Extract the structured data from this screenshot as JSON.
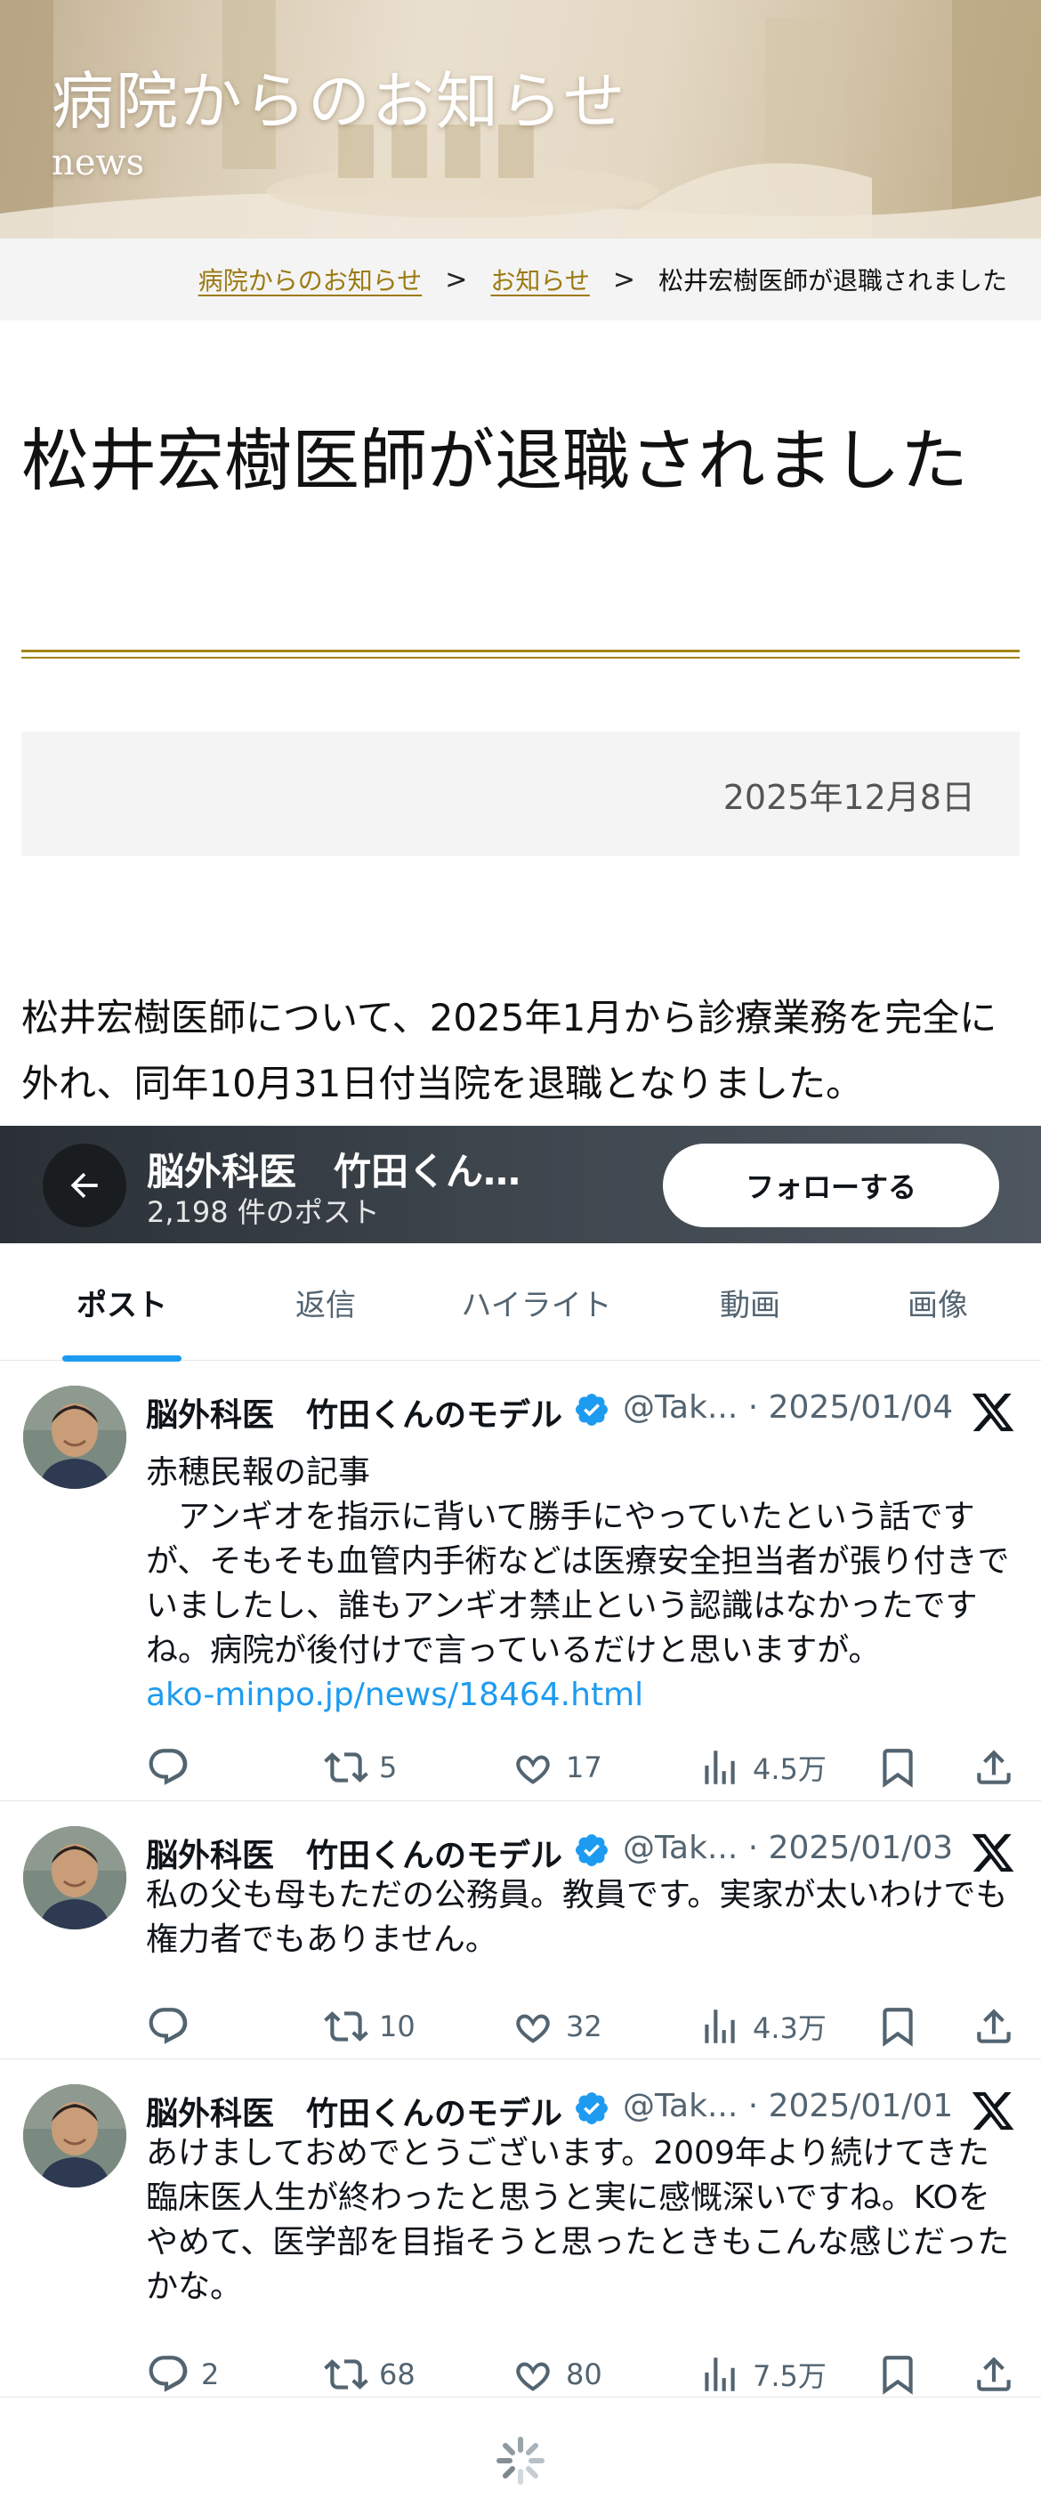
{
  "hero": {
    "title": "病院からのお知らせ",
    "subtitle": "news"
  },
  "breadcrumb": {
    "items": [
      {
        "label": "病院からのお知らせ"
      },
      {
        "label": "お知らせ"
      }
    ],
    "separator": ">",
    "current": "松井宏樹医師が退職されました"
  },
  "article": {
    "title": "松井宏樹医師が退職されました",
    "date": "2025年12月8日",
    "body": "松井宏樹医師について、2025年1月から診療業務を完全に外れ、同年10月31日付当院を退職となりました。"
  },
  "x_embed": {
    "profile_name": "脳外科医　竹田くん…",
    "post_count": "2,198 件のポスト",
    "follow_label": "フォローする",
    "tabs": [
      "ポスト",
      "返信",
      "ハイライト",
      "動画",
      "画像"
    ],
    "active_tab": 0,
    "tweets": [
      {
        "name": "脳外科医　竹田くんのモデル",
        "handle_date": "@Tak... · 2025/01/04",
        "text": "赤穂民報の記事\n　アンギオを指示に背いて勝手にやっていたという話ですが、そもそも血管内手術などは医療安全担当者が張り付きでいましたし、誰もアンギオ禁止という認識はなかったですね。病院が後付けで言っているだけと思いますが。",
        "link": "ako-minpo.jp/news/18464.html",
        "replies": "",
        "reposts": "5",
        "likes": "17",
        "views": "4.5万"
      },
      {
        "name": "脳外科医　竹田くんのモデル",
        "handle_date": "@Tak... · 2025/01/03",
        "text": "私の父も母もただの公務員。教員です。実家が太いわけでも権力者でもありません。",
        "link": "",
        "replies": "",
        "reposts": "10",
        "likes": "32",
        "views": "4.3万"
      },
      {
        "name": "脳外科医　竹田くんのモデル",
        "handle_date": "@Tak... · 2025/01/01",
        "text": "あけましておめでとうございます。2009年より続けてきた臨床医人生が終わったと思うと実に感慨深いですね。KOをやめて、医学部を目指そうと思ったときもこんな感じだったかな。",
        "link": "",
        "replies": "2",
        "reposts": "68",
        "likes": "80",
        "views": "7.5万"
      }
    ]
  },
  "colors": {
    "gold": "#9c7a12",
    "x_blue": "#1d9bf0",
    "x_gray": "#536471"
  },
  "icons": [
    "back-arrow-icon",
    "verified-badge-icon",
    "x-logo-icon",
    "reply-icon",
    "repost-icon",
    "like-icon",
    "views-icon",
    "bookmark-icon",
    "share-icon",
    "loading-spinner-icon"
  ]
}
